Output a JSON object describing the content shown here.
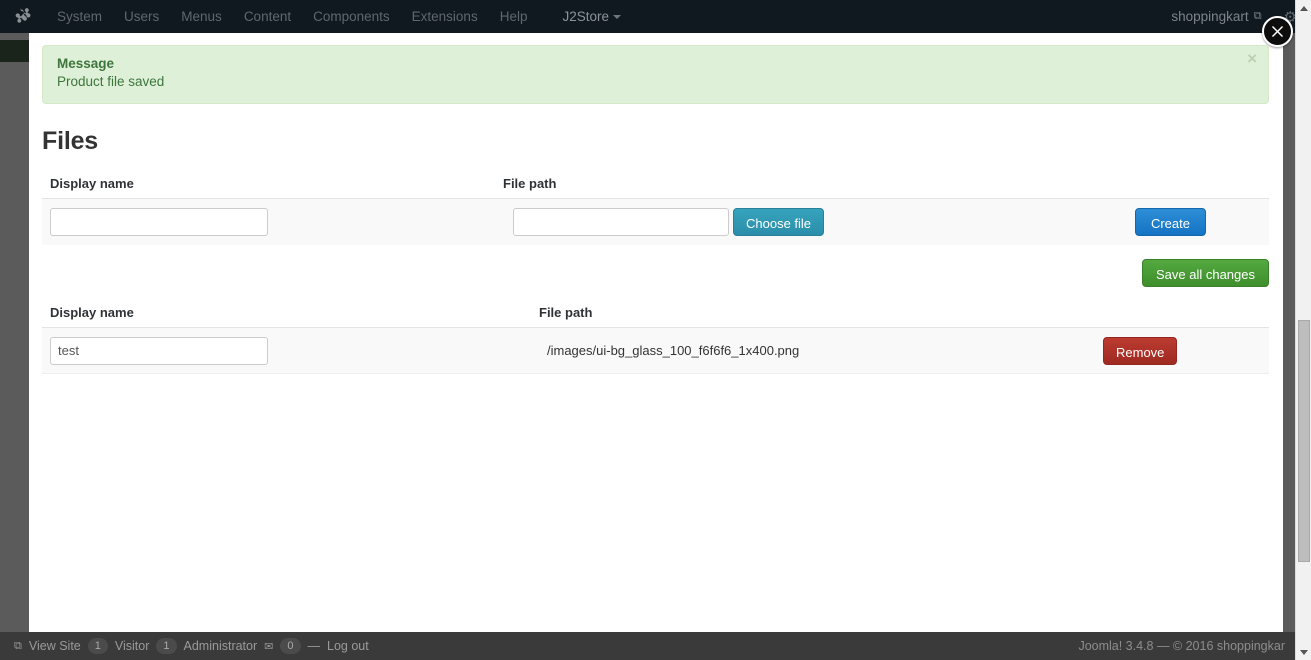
{
  "topbar": {
    "logo_icon": "joomla-logo-icon",
    "menu": [
      {
        "label": "System"
      },
      {
        "label": "Users"
      },
      {
        "label": "Menus"
      },
      {
        "label": "Content"
      },
      {
        "label": "Components"
      },
      {
        "label": "Extensions"
      },
      {
        "label": "Help"
      }
    ],
    "component_menu": {
      "label": "J2Store",
      "caret": "▾"
    },
    "user": {
      "name": "shoppingkart",
      "external_icon": "⧉"
    },
    "gear_icon": "⚙"
  },
  "modal": {
    "close_icon": "close-icon",
    "alert": {
      "title": "Message",
      "text": "Product file saved",
      "dismiss": "×"
    },
    "title": "Files",
    "create_form": {
      "headers": {
        "display_name": "Display name",
        "file_path": "File path"
      },
      "display_name_value": "",
      "display_name_placeholder": "",
      "file_path_value": "",
      "file_path_placeholder": "",
      "choose_file_label": "Choose file",
      "create_label": "Create"
    },
    "save_all_label": "Save all changes",
    "list": {
      "headers": {
        "display_name": "Display name",
        "file_path": "File path"
      },
      "rows": [
        {
          "display_name": "test",
          "file_path": "/images/ui-bg_glass_100_f6f6f6_1x400.png",
          "remove_label": "Remove"
        }
      ]
    }
  },
  "footer": {
    "view_site": "View Site",
    "visitor_count": "1",
    "visitor_label": "Visitor",
    "admin_count": "1",
    "admin_label": "Administrator",
    "mail_icon": "✉",
    "message_count": "0",
    "separator": "—",
    "log_out": "Log out",
    "copyright": "Joomla! 3.4.8  —  © 2016 shoppingkar"
  },
  "colors": {
    "topbar_bg": "#101820",
    "alert_bg": "#dff0d8",
    "alert_text": "#3c763d",
    "choose_file": "#2b8eaa",
    "create": "#1573c4",
    "save": "#3f8f2d",
    "remove": "#9e2a21"
  }
}
